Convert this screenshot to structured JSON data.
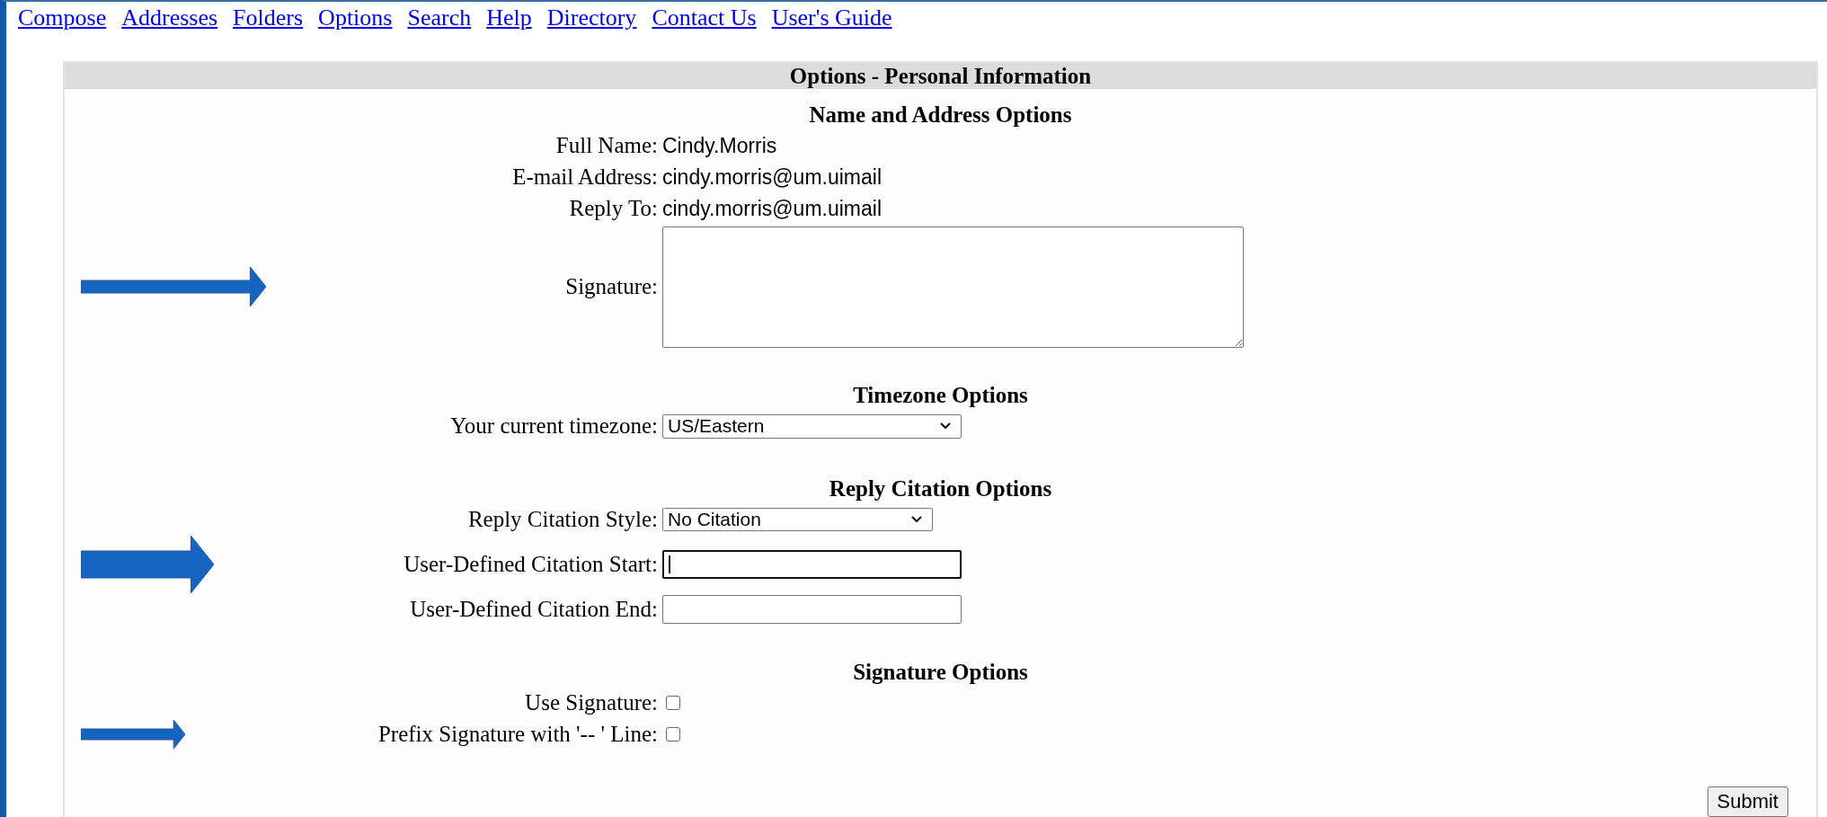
{
  "nav": [
    {
      "label": "Compose"
    },
    {
      "label": "Addresses"
    },
    {
      "label": "Folders"
    },
    {
      "label": "Options"
    },
    {
      "label": "Search"
    },
    {
      "label": "Help"
    },
    {
      "label": "Directory"
    },
    {
      "label": "Contact Us"
    },
    {
      "label": "User's Guide"
    }
  ],
  "panel": {
    "title": "Options - Personal Information",
    "sections": [
      {
        "heading": "Name and Address Options",
        "fields": [
          {
            "kind": "text",
            "label": "Full Name:",
            "value": "Cindy.Morris"
          },
          {
            "kind": "text",
            "label": "E-mail Address:",
            "value": "cindy.morris@um.uimail"
          },
          {
            "kind": "text",
            "label": "Reply To:",
            "value": "cindy.morris@um.uimail"
          },
          {
            "kind": "textarea",
            "label": "Signature:",
            "arrow": true
          }
        ]
      },
      {
        "heading": "Timezone Options",
        "fields": [
          {
            "kind": "select",
            "label": "Your current timezone:",
            "value": "US/Eastern"
          }
        ]
      },
      {
        "heading": "Reply Citation Options",
        "fields": [
          {
            "kind": "select",
            "label": "Reply Citation Style:",
            "value": "No Citation"
          },
          {
            "kind": "input",
            "label": "User-Defined Citation Start:",
            "focused": true,
            "arrow": true
          },
          {
            "kind": "input",
            "label": "User-Defined Citation End:",
            "focused": false
          }
        ]
      },
      {
        "heading": "Signature Options",
        "fields": [
          {
            "kind": "checkbox",
            "label": "Use Signature:",
            "checked": false
          },
          {
            "kind": "checkbox",
            "label": "Prefix Signature with '-- ' Line:",
            "checked": false,
            "arrow": true
          }
        ]
      }
    ],
    "submit": "Submit"
  }
}
